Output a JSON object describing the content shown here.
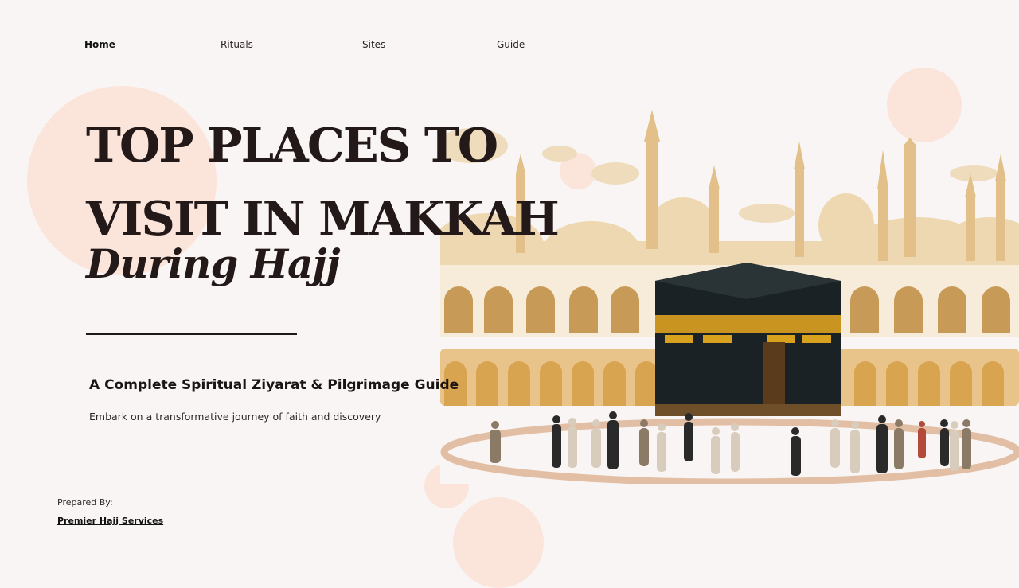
{
  "nav": {
    "items": [
      {
        "label": "Home",
        "active": true
      },
      {
        "label": "Rituals",
        "active": false
      },
      {
        "label": "Sites",
        "active": false
      },
      {
        "label": "Guide",
        "active": false
      }
    ]
  },
  "hero": {
    "title_line1": "TOP PLACES TO",
    "title_line2": "VISIT IN MAKKAH",
    "title_line3": "During Hajj",
    "subtitle": "A Complete Spiritual Ziyarat & Pilgrimage Guide",
    "description": "Embark on a transformative journey of faith and discovery"
  },
  "footer": {
    "prepared_by_label": "Prepared By:",
    "organization": "Premier Hajj Services"
  },
  "illustration": {
    "icon": "kaaba-mosque-illustration"
  },
  "colors": {
    "background": "#f9f5f4",
    "accent_circle": "#fbe5db",
    "title": "#241919",
    "sand": "#e8c98f",
    "kaaba": "#1b2226",
    "gold": "#d9a21e"
  }
}
